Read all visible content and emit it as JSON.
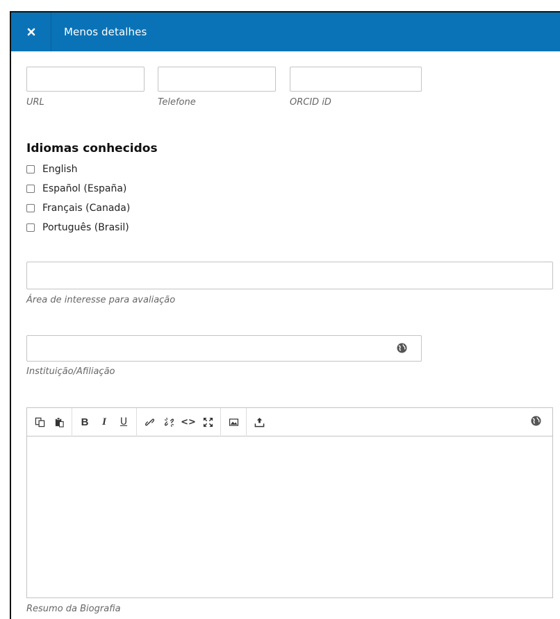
{
  "header": {
    "close_icon": "close-icon",
    "title": "Menos detalhes"
  },
  "contact_fields": [
    {
      "label": "URL",
      "value": ""
    },
    {
      "label": "Telefone",
      "value": ""
    },
    {
      "label": "ORCID iD",
      "value": ""
    }
  ],
  "languages": {
    "title": "Idiomas conhecidos",
    "items": [
      {
        "label": "English",
        "checked": false
      },
      {
        "label": "Español (España)",
        "checked": false
      },
      {
        "label": "Français (Canada)",
        "checked": false
      },
      {
        "label": "Português (Brasil)",
        "checked": false
      }
    ]
  },
  "review_interests": {
    "label": "Área de interesse para avaliação",
    "value": ""
  },
  "affiliation": {
    "label": "Instituição/Afiliação",
    "value": "",
    "icon": "globe-icon"
  },
  "biography": {
    "label": "Resumo da Biografia",
    "value": "",
    "toolbar": [
      "copy-icon",
      "paste-icon",
      "bold-icon",
      "italic-icon",
      "underline-icon",
      "link-icon",
      "unlink-icon",
      "code-icon",
      "fullscreen-icon",
      "image-icon",
      "upload-icon",
      "globe-icon"
    ],
    "bold_glyph": "B",
    "italic_glyph": "I",
    "underline_glyph": "U",
    "code_glyph": "<>"
  },
  "colors": {
    "header": "#0a73b7",
    "border": "#c3c3c3",
    "label": "#666666"
  }
}
